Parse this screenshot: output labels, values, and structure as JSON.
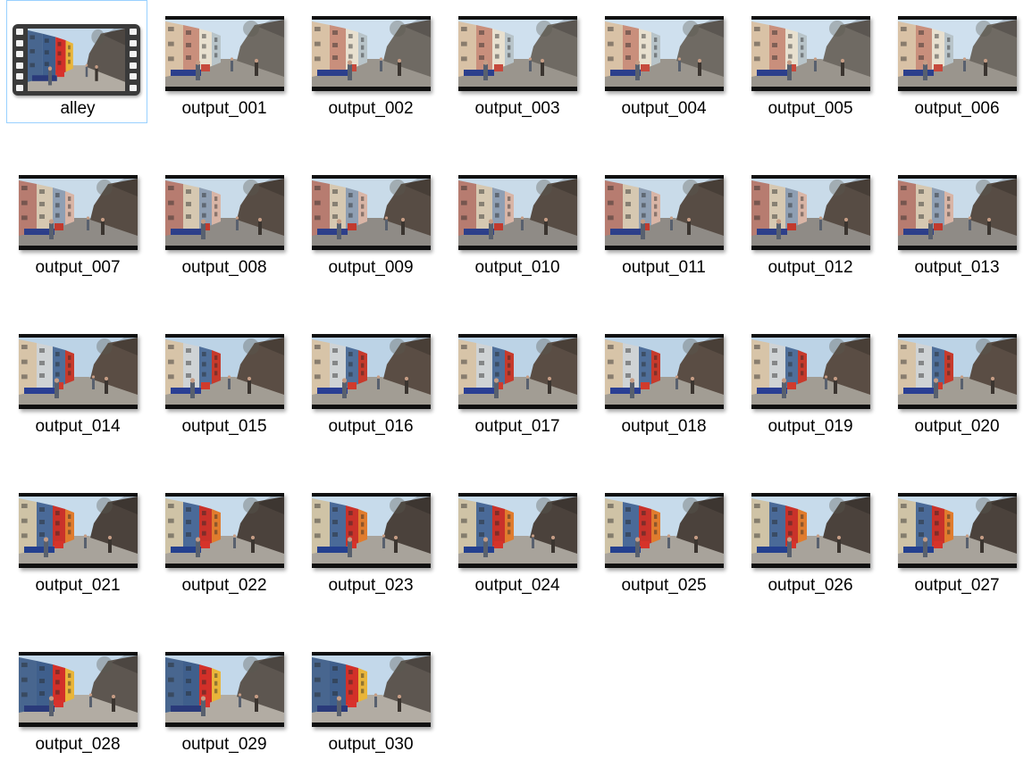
{
  "files": [
    {
      "name": "alley",
      "type": "video",
      "selected": true
    },
    {
      "name": "output_001",
      "type": "image",
      "scene": "a"
    },
    {
      "name": "output_002",
      "type": "image",
      "scene": "a"
    },
    {
      "name": "output_003",
      "type": "image",
      "scene": "a"
    },
    {
      "name": "output_004",
      "type": "image",
      "scene": "a"
    },
    {
      "name": "output_005",
      "type": "image",
      "scene": "a"
    },
    {
      "name": "output_006",
      "type": "image",
      "scene": "a"
    },
    {
      "name": "output_007",
      "type": "image",
      "scene": "b"
    },
    {
      "name": "output_008",
      "type": "image",
      "scene": "b"
    },
    {
      "name": "output_009",
      "type": "image",
      "scene": "b"
    },
    {
      "name": "output_010",
      "type": "image",
      "scene": "b"
    },
    {
      "name": "output_011",
      "type": "image",
      "scene": "b"
    },
    {
      "name": "output_012",
      "type": "image",
      "scene": "b"
    },
    {
      "name": "output_013",
      "type": "image",
      "scene": "b"
    },
    {
      "name": "output_014",
      "type": "image",
      "scene": "c"
    },
    {
      "name": "output_015",
      "type": "image",
      "scene": "c"
    },
    {
      "name": "output_016",
      "type": "image",
      "scene": "c"
    },
    {
      "name": "output_017",
      "type": "image",
      "scene": "c"
    },
    {
      "name": "output_018",
      "type": "image",
      "scene": "c"
    },
    {
      "name": "output_019",
      "type": "image",
      "scene": "c"
    },
    {
      "name": "output_020",
      "type": "image",
      "scene": "c"
    },
    {
      "name": "output_021",
      "type": "image",
      "scene": "d"
    },
    {
      "name": "output_022",
      "type": "image",
      "scene": "d"
    },
    {
      "name": "output_023",
      "type": "image",
      "scene": "d"
    },
    {
      "name": "output_024",
      "type": "image",
      "scene": "d"
    },
    {
      "name": "output_025",
      "type": "image",
      "scene": "d"
    },
    {
      "name": "output_026",
      "type": "image",
      "scene": "d"
    },
    {
      "name": "output_027",
      "type": "image",
      "scene": "d"
    },
    {
      "name": "output_028",
      "type": "image",
      "scene": "e"
    },
    {
      "name": "output_029",
      "type": "image",
      "scene": "e"
    },
    {
      "name": "output_030",
      "type": "image",
      "scene": "e"
    }
  ],
  "colors": {
    "selection_border": "#99d1ff",
    "label_text": "#000000"
  },
  "icons": {
    "video": "film-strip-icon",
    "image": "image-thumbnail"
  }
}
